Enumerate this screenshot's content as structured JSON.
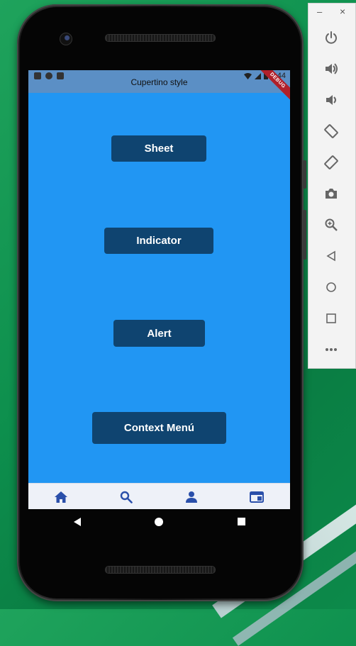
{
  "app": {
    "title": "Cupertino style",
    "debug_banner": "DEBUG",
    "status_time": "6:44"
  },
  "buttons": {
    "sheet": "Sheet",
    "indicator": "Indicator",
    "alert": "Alert",
    "context_menu": "Context Menú"
  },
  "tabs": [
    "home-icon",
    "search-icon",
    "person-icon",
    "window-icon"
  ],
  "colors": {
    "background": "#2196f3",
    "app_bar": "#5b8fc5",
    "button": "#0f4470",
    "tab_icon": "#2a4faa",
    "tab_bar": "#eef1f8"
  },
  "emulator_panel": {
    "minimize": "–",
    "close": "×",
    "tools": [
      "power-icon",
      "volume-up-icon",
      "volume-down-icon",
      "rotate-left-icon",
      "rotate-right-icon",
      "camera-icon",
      "zoom-icon",
      "back-icon",
      "home-circle-icon",
      "overview-icon",
      "more-icon"
    ]
  }
}
